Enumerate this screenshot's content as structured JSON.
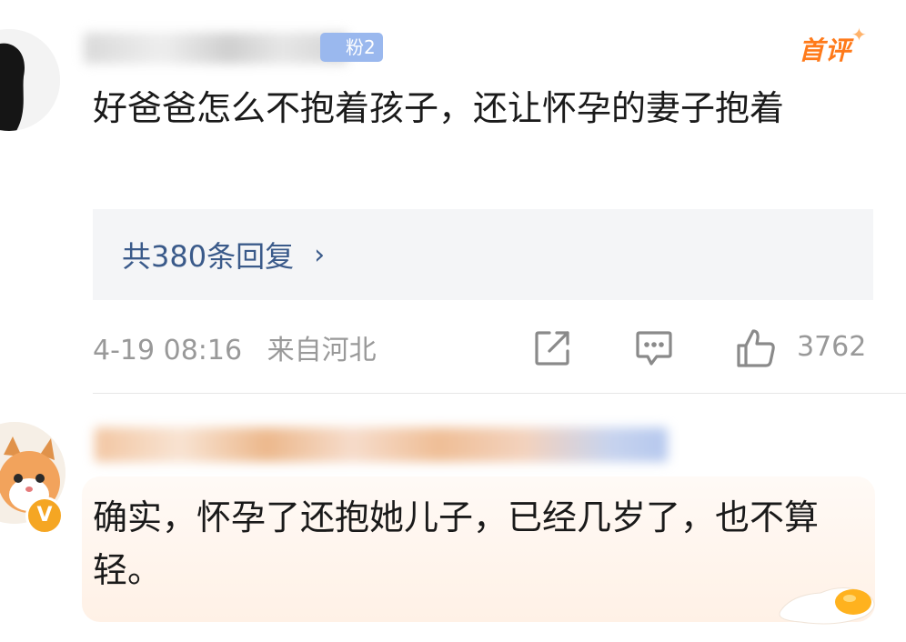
{
  "comments": [
    {
      "fan_badge": "粉2",
      "first_comment_badge": "首评",
      "text": "好爸爸怎么不抱着孩子，还让怀孕的妻子抱着",
      "replies_label": "共380条回复",
      "replies_chevron": "›",
      "date": "4-19 08:16",
      "location": "来自河北",
      "like_count": "3762"
    },
    {
      "text": "确实，怀孕了还抱她儿子，已经几岁了，也不算轻。",
      "verified_mark": "V"
    }
  ],
  "colors": {
    "accent_orange": "#ff7a1a",
    "reply_link": "#3a5a8a",
    "meta_gray": "#999999",
    "fan_badge_blue": "#9ab8ee",
    "verified_gold": "#f5a623"
  },
  "icons": {
    "share": "share-icon",
    "comment": "comment-icon",
    "like": "thumbs-up-icon"
  }
}
